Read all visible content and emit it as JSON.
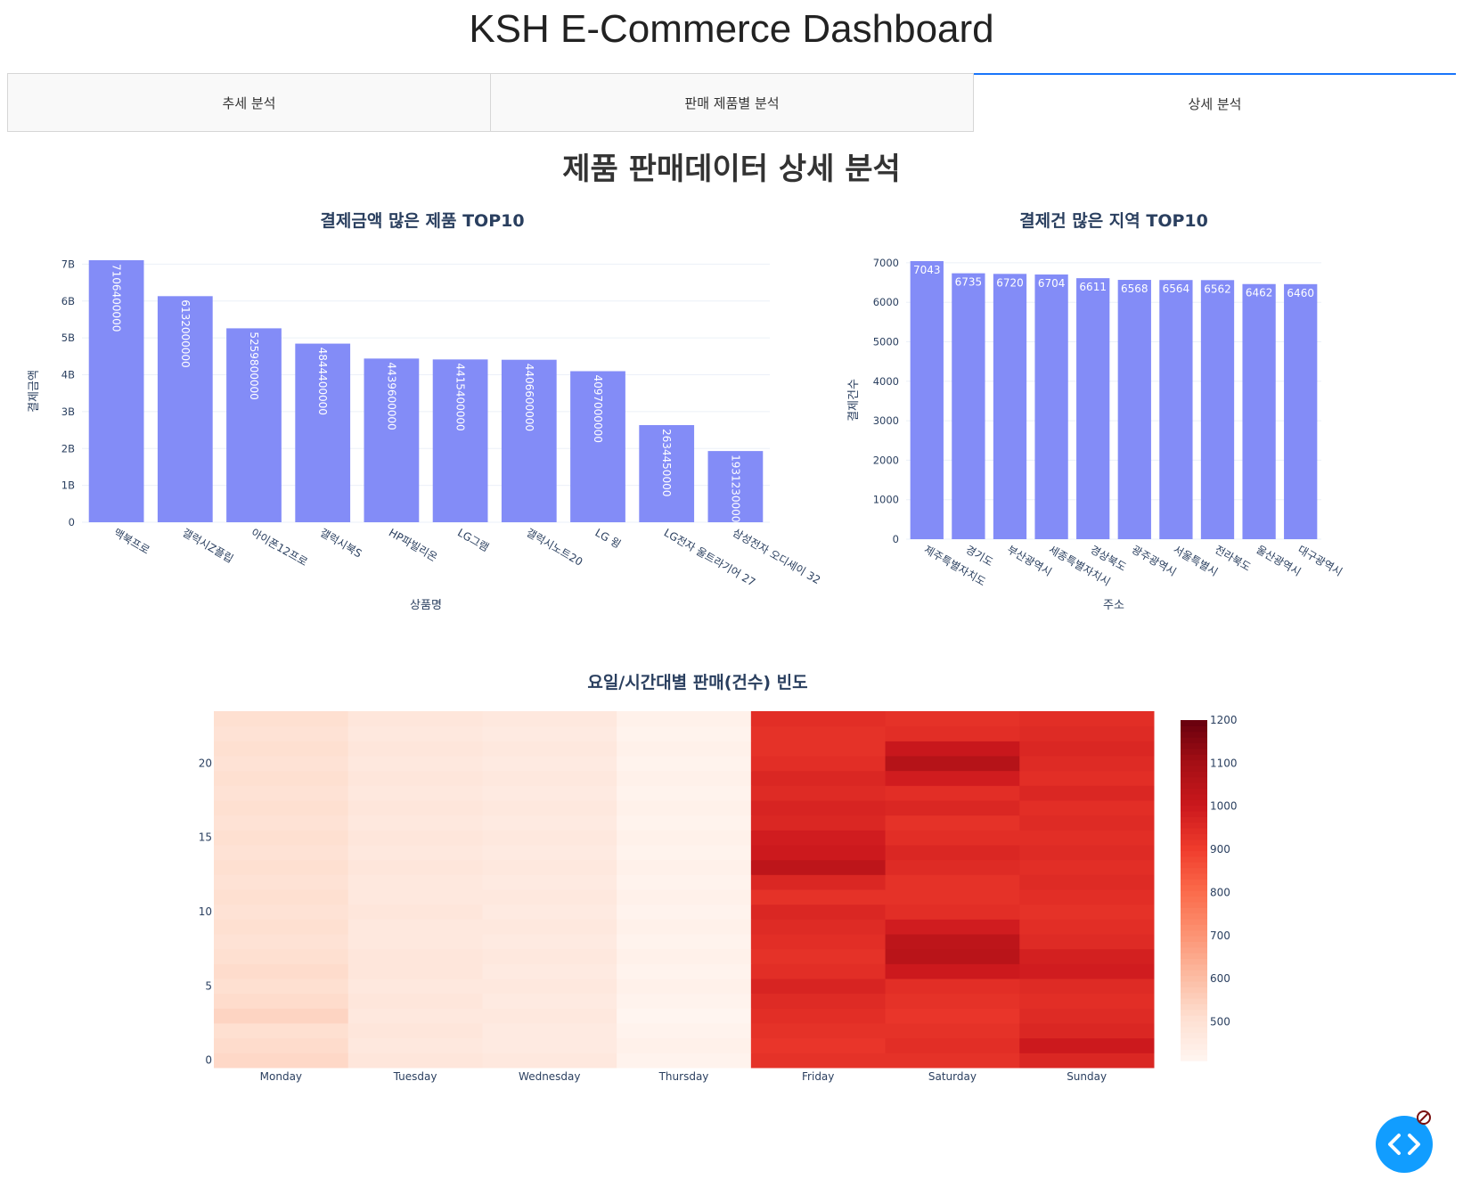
{
  "header": {
    "title": "KSH E-Commerce Dashboard"
  },
  "tabs": [
    {
      "label": "추세 분석",
      "active": false
    },
    {
      "label": "판매 제품별 분석",
      "active": false
    },
    {
      "label": "상세 분석",
      "active": true
    }
  ],
  "section_title": "제품 판매데이터 상세 분석",
  "colors": {
    "bar": "#838cf7",
    "tab_accent": "#1975fa",
    "fab": "#119dff"
  },
  "fab": {
    "icon": "code-icon"
  },
  "chart_data": [
    {
      "type": "bar",
      "title": "결제금액 많은 제품 TOP10",
      "xlabel": "상품명",
      "ylabel": "결제금액",
      "categories": [
        "맥북프로",
        "갤럭시Z플립",
        "아이폰12프로",
        "갤럭시북S",
        "HP파빌리온",
        "LG그램",
        "갤럭시노트20",
        "LG 윙",
        "LG전자 울트라기어 27",
        "삼성전자 오디세이 32"
      ],
      "values": [
        7106400000,
        6132000000,
        5259800000,
        4844400000,
        4439600000,
        4415400000,
        4406600000,
        4097000000,
        2634450000,
        1931230000
      ],
      "data_labels": [
        "7106400000",
        "6132000000",
        "5259800000",
        "4844400000",
        "4439600000",
        "4415400000",
        "4406600000",
        "4097000000",
        "2634450000",
        "1931230000"
      ],
      "ylim": [
        0,
        7106400000
      ],
      "y_ticks": [
        0,
        1000000000,
        2000000000,
        3000000000,
        4000000000,
        5000000000,
        6000000000,
        7000000000
      ],
      "y_tick_labels": [
        "0",
        "1B",
        "2B",
        "3B",
        "4B",
        "5B",
        "6B",
        "7B"
      ],
      "grid": true
    },
    {
      "type": "bar",
      "title": "결제건 많은 지역 TOP10",
      "xlabel": "주소",
      "ylabel": "결제건수",
      "categories": [
        "제주특별자치도",
        "경기도",
        "부산광역시",
        "세종특별자치시",
        "경상북도",
        "광주광역시",
        "서울특별시",
        "전라북도",
        "울산광역시",
        "대구광역시"
      ],
      "values": [
        7043,
        6735,
        6720,
        6704,
        6611,
        6568,
        6564,
        6562,
        6462,
        6460
      ],
      "data_labels": [
        "7043",
        "6735",
        "6720",
        "6704",
        "6611",
        "6568",
        "6564",
        "6562",
        "6462",
        "6460"
      ],
      "ylim": [
        0,
        7043
      ],
      "y_ticks": [
        0,
        1000,
        2000,
        3000,
        4000,
        5000,
        6000,
        7000
      ],
      "y_tick_labels": [
        "0",
        "1000",
        "2000",
        "3000",
        "4000",
        "5000",
        "6000",
        "7000"
      ],
      "grid": true
    },
    {
      "type": "heatmap",
      "title": "요일/시간대별 판매(건수) 빈도",
      "x": [
        "Monday",
        "Tuesday",
        "Wednesday",
        "Thursday",
        "Friday",
        "Saturday",
        "Sunday"
      ],
      "y": [
        0,
        1,
        2,
        3,
        4,
        5,
        6,
        7,
        8,
        9,
        10,
        11,
        12,
        13,
        14,
        15,
        16,
        17,
        18,
        19,
        20,
        21,
        22,
        23
      ],
      "y_ticks": [
        0,
        5,
        10,
        15,
        20
      ],
      "colorscale": "Reds",
      "zlim": [
        410,
        1200
      ],
      "colorbar_ticks": [
        500,
        600,
        700,
        800,
        900,
        1000,
        1100,
        1200
      ],
      "z": [
        [
          530,
          480,
          470,
          420,
          930,
          930,
          960
        ],
        [
          520,
          470,
          460,
          430,
          920,
          940,
          1000
        ],
        [
          510,
          480,
          460,
          420,
          930,
          930,
          960
        ],
        [
          540,
          470,
          470,
          410,
          940,
          920,
          950
        ],
        [
          520,
          480,
          460,
          420,
          950,
          930,
          940
        ],
        [
          510,
          470,
          470,
          430,
          970,
          940,
          950
        ],
        [
          520,
          480,
          460,
          420,
          940,
          1000,
          990
        ],
        [
          510,
          480,
          470,
          430,
          930,
          1050,
          980
        ],
        [
          500,
          470,
          460,
          420,
          940,
          1040,
          950
        ],
        [
          510,
          470,
          470,
          430,
          950,
          990,
          940
        ],
        [
          500,
          480,
          460,
          420,
          960,
          940,
          930
        ],
        [
          510,
          470,
          470,
          430,
          930,
          930,
          940
        ],
        [
          500,
          470,
          460,
          420,
          960,
          930,
          950
        ],
        [
          510,
          480,
          470,
          430,
          1040,
          950,
          940
        ],
        [
          500,
          470,
          460,
          420,
          1000,
          960,
          950
        ],
        [
          510,
          480,
          470,
          430,
          990,
          940,
          940
        ],
        [
          500,
          470,
          460,
          420,
          960,
          930,
          950
        ],
        [
          510,
          480,
          470,
          430,
          970,
          960,
          940
        ],
        [
          500,
          470,
          460,
          420,
          950,
          940,
          960
        ],
        [
          510,
          480,
          470,
          430,
          960,
          990,
          940
        ],
        [
          500,
          470,
          460,
          420,
          940,
          1060,
          950
        ],
        [
          510,
          480,
          470,
          430,
          930,
          1010,
          960
        ],
        [
          500,
          470,
          460,
          420,
          930,
          940,
          950
        ],
        [
          510,
          480,
          470,
          430,
          940,
          930,
          940
        ]
      ]
    }
  ]
}
